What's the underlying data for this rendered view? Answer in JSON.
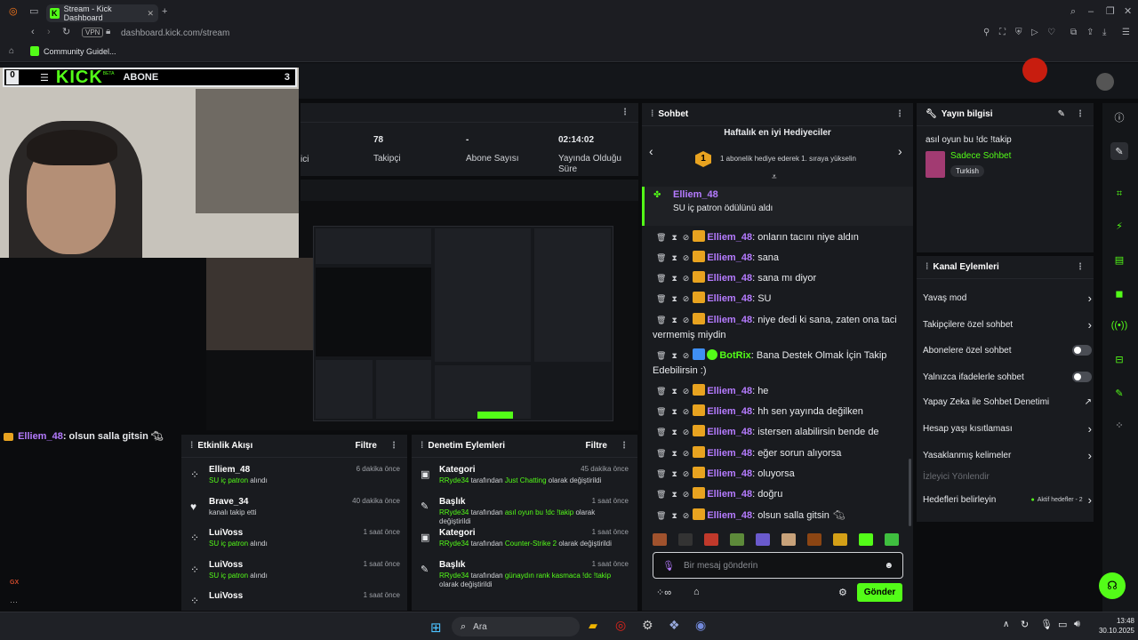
{
  "browser": {
    "tab_title": "Stream - Kick Dashboard",
    "url_host": "dashboard.kick.com",
    "url_path": "/stream",
    "vpn_label": "VPN",
    "bookmark": "Community Guidel..."
  },
  "overlay": {
    "sub_label": "ABONE",
    "sub_count": "3",
    "left_num": "0",
    "logo": "KICK",
    "logo_tag": "BETA",
    "chat_user": "Elliem_48",
    "chat_msg": ": olsun salla gitsin",
    "gx": "GX"
  },
  "stats": [
    {
      "value": "78",
      "label": "Takipçi"
    },
    {
      "value": "-",
      "label": "Abone Sayısı"
    },
    {
      "value": "02:14:02",
      "label": "Yayında Olduğu Süre"
    }
  ],
  "stats_partial_label": "ici",
  "chat": {
    "title": "Sohbet",
    "gifters_title": "Haftalık en iyi Hediyeciler",
    "gifters_rank": "1",
    "gifters_text": "1 abonelik hediye ederek 1. sıraya yükselin",
    "pinned_user": "Elliem_48",
    "pinned_text": "SU iç patron ödülünü aldı",
    "messages": [
      {
        "user": "Elliem_48",
        "text": ": onların tacını niye aldın",
        "bot": false
      },
      {
        "user": "Elliem_48",
        "text": ": sana",
        "bot": false
      },
      {
        "user": "Elliem_48",
        "text": ": sana mı diyor",
        "bot": false
      },
      {
        "user": "Elliem_48",
        "text": ": SU",
        "bot": false
      },
      {
        "user": "Elliem_48",
        "text": ": niye dedi ki sana, zaten ona taci vermemiş miydin",
        "bot": false
      },
      {
        "user": "BotRix",
        "text": ": Bana Destek Olmak İçin Takip Edebilirsin :)",
        "bot": true
      },
      {
        "user": "Elliem_48",
        "text": ": he",
        "bot": false
      },
      {
        "user": "Elliem_48",
        "text": ": hh sen yayında değilken",
        "bot": false
      },
      {
        "user": "Elliem_48",
        "text": ": istersen alabilirsin bende de",
        "bot": false
      },
      {
        "user": "Elliem_48",
        "text": ": eğer sorun alıyorsa",
        "bot": false
      },
      {
        "user": "Elliem_48",
        "text": ": oluyorsa",
        "bot": false
      },
      {
        "user": "Elliem_48",
        "text": ": doğru",
        "bot": false
      },
      {
        "user": "Elliem_48",
        "text": ": olsun salla gitsin",
        "bot": false
      }
    ],
    "input_placeholder": "Bir mesaj gönderin",
    "send_label": "Gönder"
  },
  "stream_info": {
    "title": "Yayın bilgisi",
    "stream_title": "asıl oyun bu !dc !takip",
    "category": "Sadece Sohbet",
    "language": "Turkish"
  },
  "channel_actions": {
    "title": "Kanal Eylemleri",
    "items": [
      {
        "label": "Yavaş mod",
        "kind": "chevron"
      },
      {
        "label": "Takipçilere özel sohbet",
        "kind": "chevron"
      },
      {
        "label": "Abonelere özel sohbet",
        "kind": "toggle"
      },
      {
        "label": "Yalnızca ifadelerle sohbet",
        "kind": "toggle"
      },
      {
        "label": "Yapay Zeka ile Sohbet Denetimi",
        "kind": "external"
      },
      {
        "label": "Hesap yaşı kısıtlaması",
        "kind": "chevron"
      },
      {
        "label": "Yasaklanmış kelimeler",
        "kind": "chevron"
      },
      {
        "label": "İzleyici Yönlendir",
        "kind": "disabled"
      },
      {
        "label": "Hedefleri belirleyin",
        "kind": "goal"
      }
    ],
    "goal_status": "Aktif hedefler - 2"
  },
  "activity": {
    "title": "Etkinlik Akışı",
    "filter": "Filtre",
    "items": [
      {
        "user": "Elliem_48",
        "desc_highlight": "SU iç patron",
        "desc": " alındı",
        "time": "6 dakika önce"
      },
      {
        "user": "Brave_34",
        "desc_highlight": "",
        "desc": "kanalı takip etti",
        "time": "40 dakika önce"
      },
      {
        "user": "LuiVoss",
        "desc_highlight": "SU iç patron",
        "desc": " alındı",
        "time": "1 saat önce"
      },
      {
        "user": "LuiVoss",
        "desc_highlight": "SU iç patron",
        "desc": " alındı",
        "time": "1 saat önce"
      },
      {
        "user": "LuiVoss",
        "desc_highlight": "",
        "desc": "",
        "time": "1 saat önce"
      }
    ]
  },
  "moderation": {
    "title": "Denetim Eylemleri",
    "filter": "Filtre",
    "items": [
      {
        "type": "Kategori",
        "actor": "RRyde34",
        "mid": " tarafından ",
        "value": "Just Chatting",
        "tail": " olarak değiştirildi",
        "time": "45 dakika önce"
      },
      {
        "type": "Başlık",
        "actor": "RRyde34",
        "mid": " tarafından ",
        "value": "asıl oyun bu !dc !takip",
        "tail": " olarak değiştirildi",
        "time": "1 saat önce"
      },
      {
        "type": "Kategori",
        "actor": "RRyde34",
        "mid": " tarafından ",
        "value": "Counter-Strike 2",
        "tail": " olarak değiştirildi",
        "time": "1 saat önce"
      },
      {
        "type": "Başlık",
        "actor": "RRyde34",
        "mid": " tarafından ",
        "value": "günaydın rank kasmaca !dc !takip",
        "tail": " olarak değiştirildi",
        "time": "1 saat önce"
      }
    ]
  },
  "taskbar": {
    "search": "Ara",
    "time": "13:48",
    "date": "30.10.2025"
  },
  "colors": {
    "accent": "#53fc18",
    "username": "#b57bff",
    "panel": "#191b1f"
  }
}
